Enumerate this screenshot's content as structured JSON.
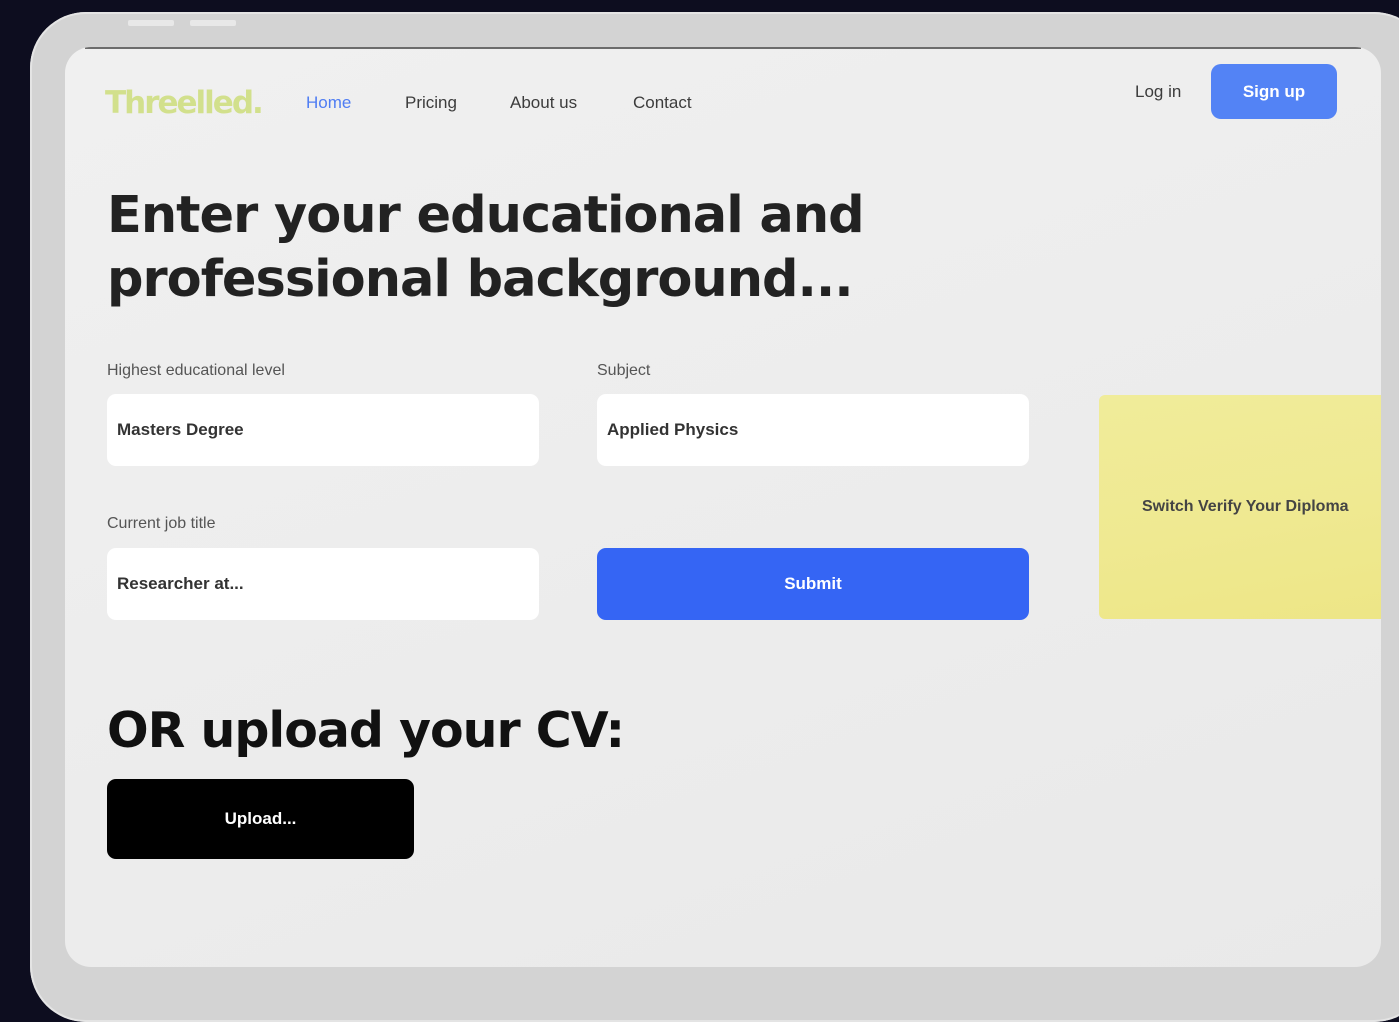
{
  "brand": {
    "logo_text": "Threelled.",
    "logo_color": "#d2e08c"
  },
  "nav": {
    "items": [
      {
        "label": "Home",
        "active": true
      },
      {
        "label": "Pricing",
        "active": false
      },
      {
        "label": "About us",
        "active": false
      },
      {
        "label": "Contact",
        "active": false
      }
    ],
    "login_label": "Log in",
    "signup_label": "Sign up"
  },
  "hero": {
    "line1": "Enter your educational and",
    "line2": "professional background..."
  },
  "form": {
    "education": {
      "label": "Highest educational level",
      "value": "Masters Degree"
    },
    "subject": {
      "label": "Subject",
      "value": "Applied Physics"
    },
    "job": {
      "label": "Current job title",
      "value": "Researcher at..."
    },
    "submit_label": "Submit"
  },
  "verify_card": {
    "text": "Switch Verify Your Diploma"
  },
  "upload_section": {
    "heading": "OR upload your CV:",
    "button_label": "Upload..."
  },
  "colors": {
    "accent_blue": "#5383f5",
    "submit_blue": "#3565f4",
    "card_yellow": "#efe991",
    "background": "#0d0d1f"
  }
}
